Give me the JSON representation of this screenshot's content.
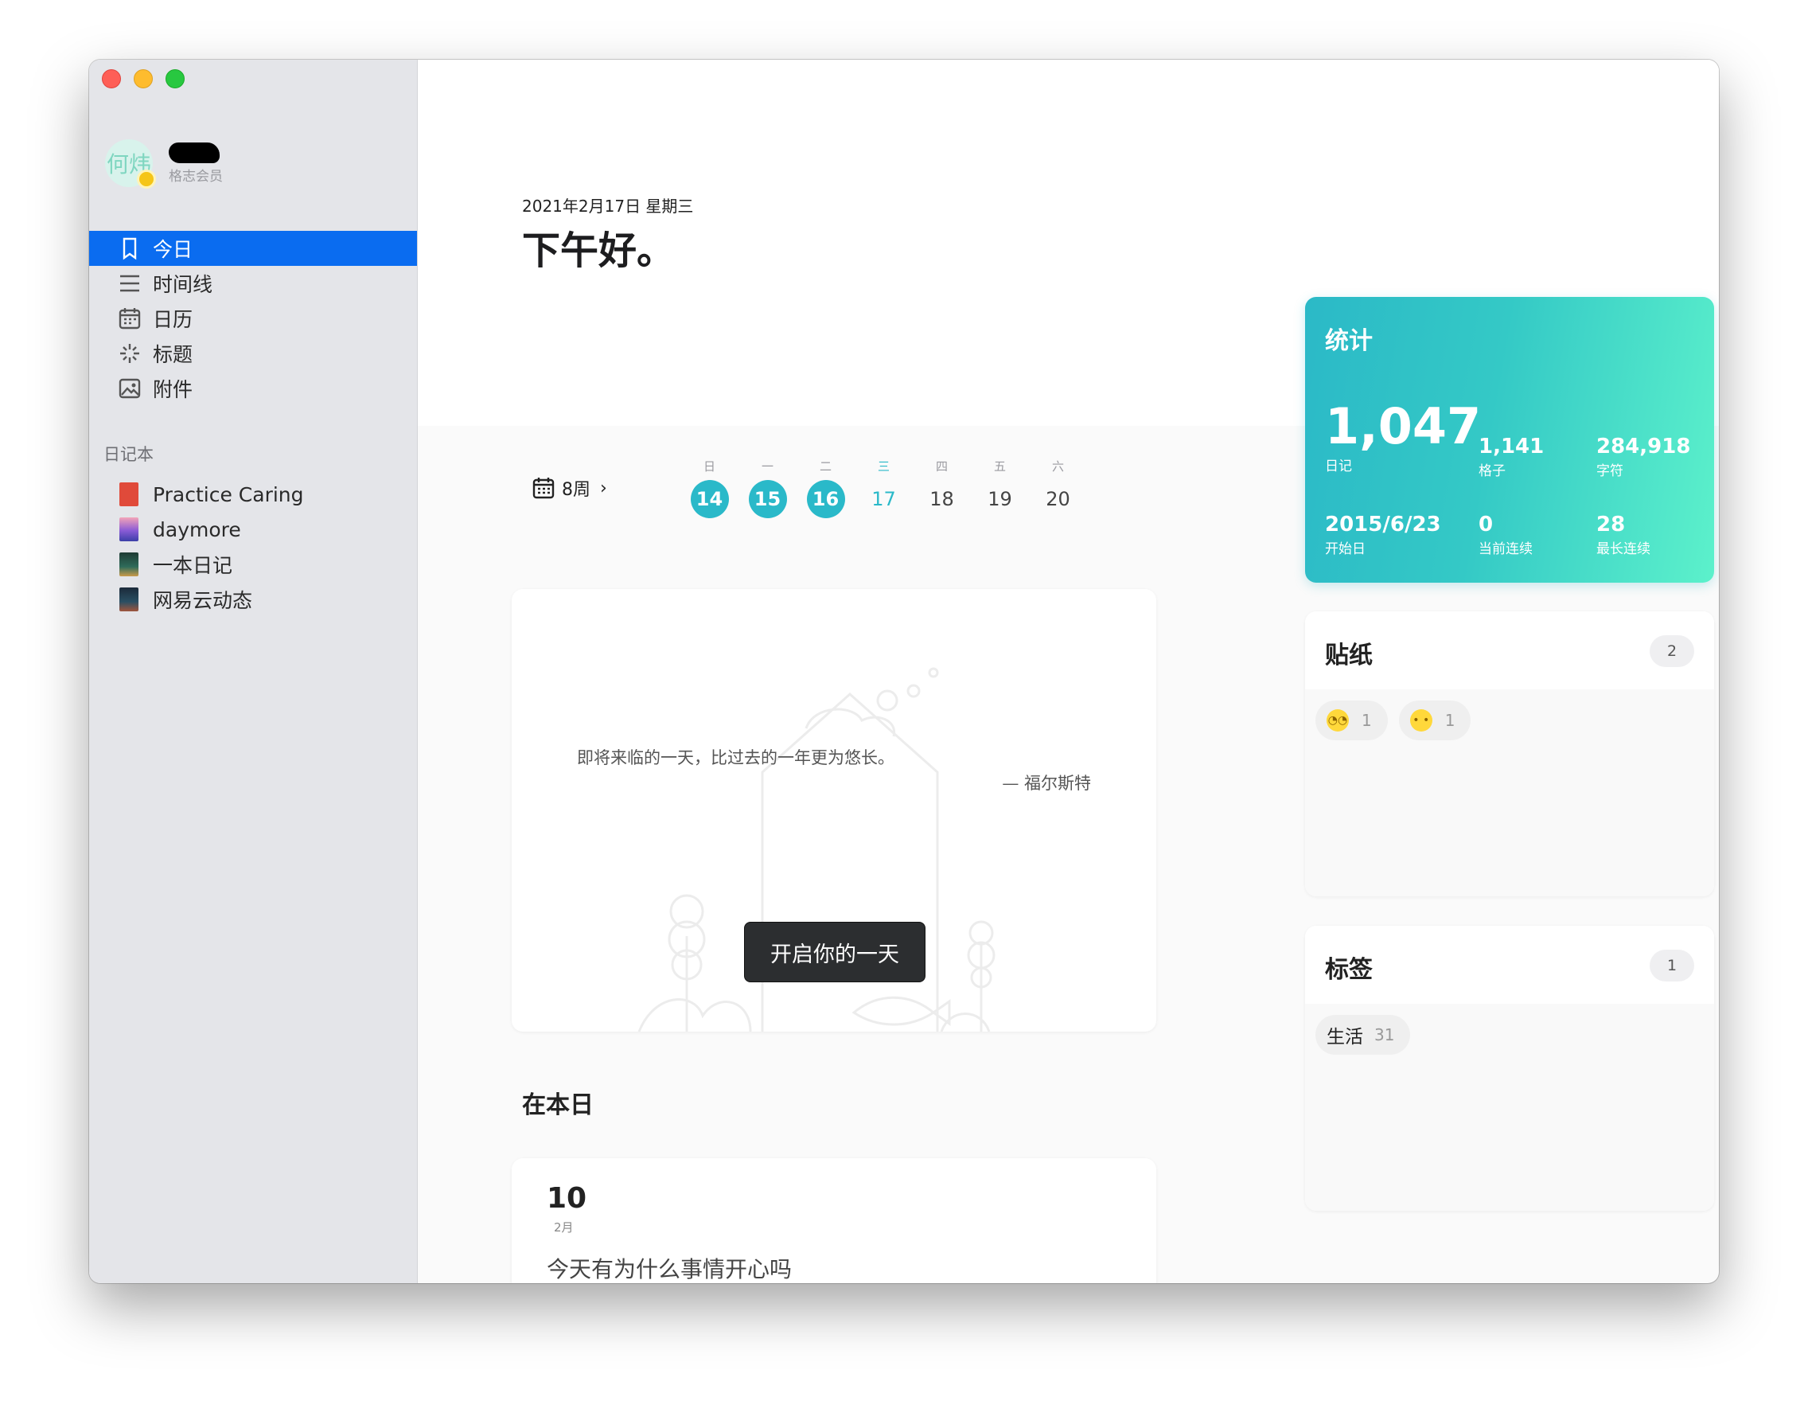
{
  "sidebar": {
    "profile": {
      "avatar_text": "何炜",
      "member_label": "格志会员"
    },
    "nav": [
      {
        "label": "今日",
        "icon": "bookmark-icon",
        "active": true
      },
      {
        "label": "时间线",
        "icon": "list-icon"
      },
      {
        "label": "日历",
        "icon": "calendar-icon"
      },
      {
        "label": "标题",
        "icon": "sparkle-icon"
      },
      {
        "label": "附件",
        "icon": "image-icon"
      }
    ],
    "notebooks_title": "日记本",
    "notebooks": [
      {
        "label": "Practice Caring",
        "color": "#e04a3a"
      },
      {
        "label": "daymore",
        "color": "#8a5bd6"
      },
      {
        "label": "一本日记",
        "color": "#2e6b5a"
      },
      {
        "label": "网易云动态",
        "color": "#2a4f63"
      }
    ]
  },
  "main": {
    "date": "2021年2月17日 星期三",
    "greeting": "下午好。",
    "week": {
      "label": "8周",
      "days": [
        {
          "dow": "日",
          "num": "14",
          "state": "done"
        },
        {
          "dow": "一",
          "num": "15",
          "state": "done"
        },
        {
          "dow": "二",
          "num": "16",
          "state": "done"
        },
        {
          "dow": "三",
          "num": "17",
          "state": "today"
        },
        {
          "dow": "四",
          "num": "18",
          "state": ""
        },
        {
          "dow": "五",
          "num": "19",
          "state": ""
        },
        {
          "dow": "六",
          "num": "20",
          "state": ""
        }
      ]
    },
    "quote": {
      "text": "即将来临的一天，比过去的一年更为悠长。",
      "author": "— 福尔斯特"
    },
    "start_button": "开启你的一天",
    "on_this_day": {
      "title": "在本日",
      "day": "10",
      "month": "2月",
      "text": "今天有为什么事情开心吗"
    }
  },
  "stats": {
    "title": "统计",
    "entries": {
      "value": "1,047",
      "label": "日记"
    },
    "cells": {
      "value": "1,141",
      "label": "格子"
    },
    "chars": {
      "value": "284,918",
      "label": "字符"
    },
    "start": {
      "value": "2015/6/23",
      "label": "开始日"
    },
    "current_streak": {
      "value": "0",
      "label": "当前连续"
    },
    "longest_streak": {
      "value": "28",
      "label": "最长连续"
    }
  },
  "stickers": {
    "title": "贴纸",
    "count": "2",
    "items": [
      {
        "emoji": "eye-roll-face-icon",
        "count": "1"
      },
      {
        "emoji": "confused-face-icon",
        "count": "1"
      }
    ]
  },
  "tags": {
    "title": "标签",
    "count": "1",
    "items": [
      {
        "label": "生活",
        "count": "31"
      }
    ]
  },
  "colors": {
    "accent": "#0a6cf0",
    "teal": "#2ab9c9",
    "stats_end": "#5cf1cb"
  }
}
